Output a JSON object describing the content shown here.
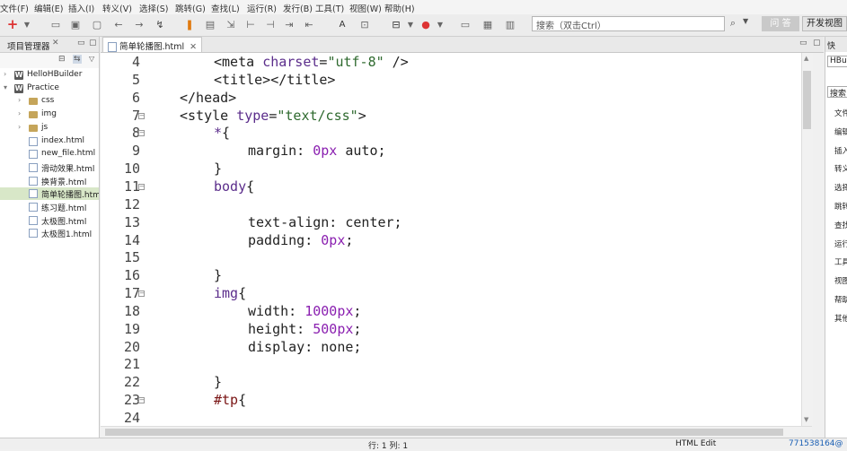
{
  "menu": [
    "文件(F)",
    "编辑(E)",
    "插入(I)",
    "转义(V)",
    "选择(S)",
    "跳转(G)",
    "查找(L)",
    "运行(R)",
    "发行(B)",
    "工具(T)",
    "视图(W)",
    "帮助(H)"
  ],
  "search": {
    "placeholder": "搜索（双击Ctrl）"
  },
  "qa_label": "问 答",
  "perspective_label": "开发视图",
  "project_panel": {
    "title": "项目管理器",
    "items": [
      {
        "label": "HelloHBuilder",
        "type": "project",
        "level": 0,
        "expanded": false
      },
      {
        "label": "Practice",
        "type": "project",
        "level": 0,
        "expanded": true
      },
      {
        "label": "css",
        "type": "folder",
        "level": 1,
        "expanded": false
      },
      {
        "label": "img",
        "type": "folder",
        "level": 1,
        "expanded": false
      },
      {
        "label": "js",
        "type": "folder",
        "level": 1,
        "expanded": false
      },
      {
        "label": "index.html",
        "type": "file",
        "level": 1
      },
      {
        "label": "new_file.html",
        "type": "file",
        "level": 1
      },
      {
        "label": "滑动效果.html",
        "type": "file",
        "level": 1
      },
      {
        "label": "换背景.html",
        "type": "file",
        "level": 1
      },
      {
        "label": "简单轮播图.html",
        "type": "file",
        "level": 1,
        "selected": true
      },
      {
        "label": "练习题.html",
        "type": "file",
        "level": 1
      },
      {
        "label": "太极图.html",
        "type": "file",
        "level": 1
      },
      {
        "label": "太极图1.html",
        "type": "file",
        "level": 1
      }
    ]
  },
  "editor": {
    "tab_label": "简单轮播图.html",
    "lines": [
      {
        "n": "4",
        "fold": false,
        "indent": 2,
        "tokens": [
          [
            "tag",
            "<meta "
          ],
          [
            "attr",
            "charset"
          ],
          [
            "tag",
            "="
          ],
          [
            "str",
            "\"utf-8\""
          ],
          [
            "tag",
            " />"
          ]
        ]
      },
      {
        "n": "5",
        "fold": false,
        "indent": 2,
        "tokens": [
          [
            "tag",
            "<title></title>"
          ]
        ]
      },
      {
        "n": "6",
        "fold": false,
        "indent": 1,
        "tokens": [
          [
            "tag",
            "</head>"
          ]
        ]
      },
      {
        "n": "7",
        "fold": true,
        "indent": 1,
        "tokens": [
          [
            "tag",
            "<style "
          ],
          [
            "attr",
            "type"
          ],
          [
            "tag",
            "="
          ],
          [
            "str",
            "\"text/css\""
          ],
          [
            "tag",
            ">"
          ]
        ]
      },
      {
        "n": "8",
        "fold": true,
        "indent": 2,
        "tokens": [
          [
            "sel",
            "*"
          ],
          [
            "tag",
            "{"
          ]
        ]
      },
      {
        "n": "9",
        "fold": false,
        "indent": 3,
        "tokens": [
          [
            "prop",
            "margin: "
          ],
          [
            "num",
            "0px"
          ],
          [
            "prop",
            " auto;"
          ]
        ]
      },
      {
        "n": "10",
        "fold": false,
        "indent": 2,
        "tokens": [
          [
            "tag",
            "}"
          ]
        ]
      },
      {
        "n": "11",
        "fold": true,
        "indent": 2,
        "tokens": [
          [
            "sel",
            "body"
          ],
          [
            "tag",
            "{"
          ]
        ]
      },
      {
        "n": "12",
        "fold": false,
        "indent": 0,
        "tokens": []
      },
      {
        "n": "13",
        "fold": false,
        "indent": 3,
        "tokens": [
          [
            "prop",
            "text-align: center;"
          ]
        ]
      },
      {
        "n": "14",
        "fold": false,
        "indent": 3,
        "tokens": [
          [
            "prop",
            "padding: "
          ],
          [
            "num",
            "0px"
          ],
          [
            "prop",
            ";"
          ]
        ]
      },
      {
        "n": "15",
        "fold": false,
        "indent": 0,
        "tokens": []
      },
      {
        "n": "16",
        "fold": false,
        "indent": 2,
        "tokens": [
          [
            "tag",
            "}"
          ]
        ]
      },
      {
        "n": "17",
        "fold": true,
        "indent": 2,
        "tokens": [
          [
            "sel",
            "img"
          ],
          [
            "tag",
            "{"
          ]
        ]
      },
      {
        "n": "18",
        "fold": false,
        "indent": 3,
        "tokens": [
          [
            "prop",
            "width: "
          ],
          [
            "num",
            "1000px"
          ],
          [
            "prop",
            ";"
          ]
        ]
      },
      {
        "n": "19",
        "fold": false,
        "indent": 3,
        "tokens": [
          [
            "prop",
            "height: "
          ],
          [
            "num",
            "500px"
          ],
          [
            "prop",
            ";"
          ]
        ]
      },
      {
        "n": "20",
        "fold": false,
        "indent": 3,
        "tokens": [
          [
            "prop",
            "display: none;"
          ]
        ]
      },
      {
        "n": "21",
        "fold": false,
        "indent": 0,
        "tokens": []
      },
      {
        "n": "22",
        "fold": false,
        "indent": 2,
        "tokens": [
          [
            "tag",
            "}"
          ]
        ]
      },
      {
        "n": "23",
        "fold": true,
        "indent": 2,
        "tokens": [
          [
            "id",
            "#tp"
          ],
          [
            "tag",
            "{"
          ]
        ]
      },
      {
        "n": "24",
        "fold": false,
        "indent": 0,
        "tokens": []
      }
    ]
  },
  "right_panel": {
    "title": "快",
    "header_box": "HBui",
    "search_box": "搜索",
    "items": [
      "文件",
      "编辑",
      "插入",
      "转义",
      "选择",
      "跳转",
      "查找",
      "运行",
      "工具",
      "视图",
      "帮助",
      "其他"
    ]
  },
  "status": {
    "position": "行: 1 列: 1",
    "mode": "HTML Edit",
    "user": "771538164@"
  }
}
